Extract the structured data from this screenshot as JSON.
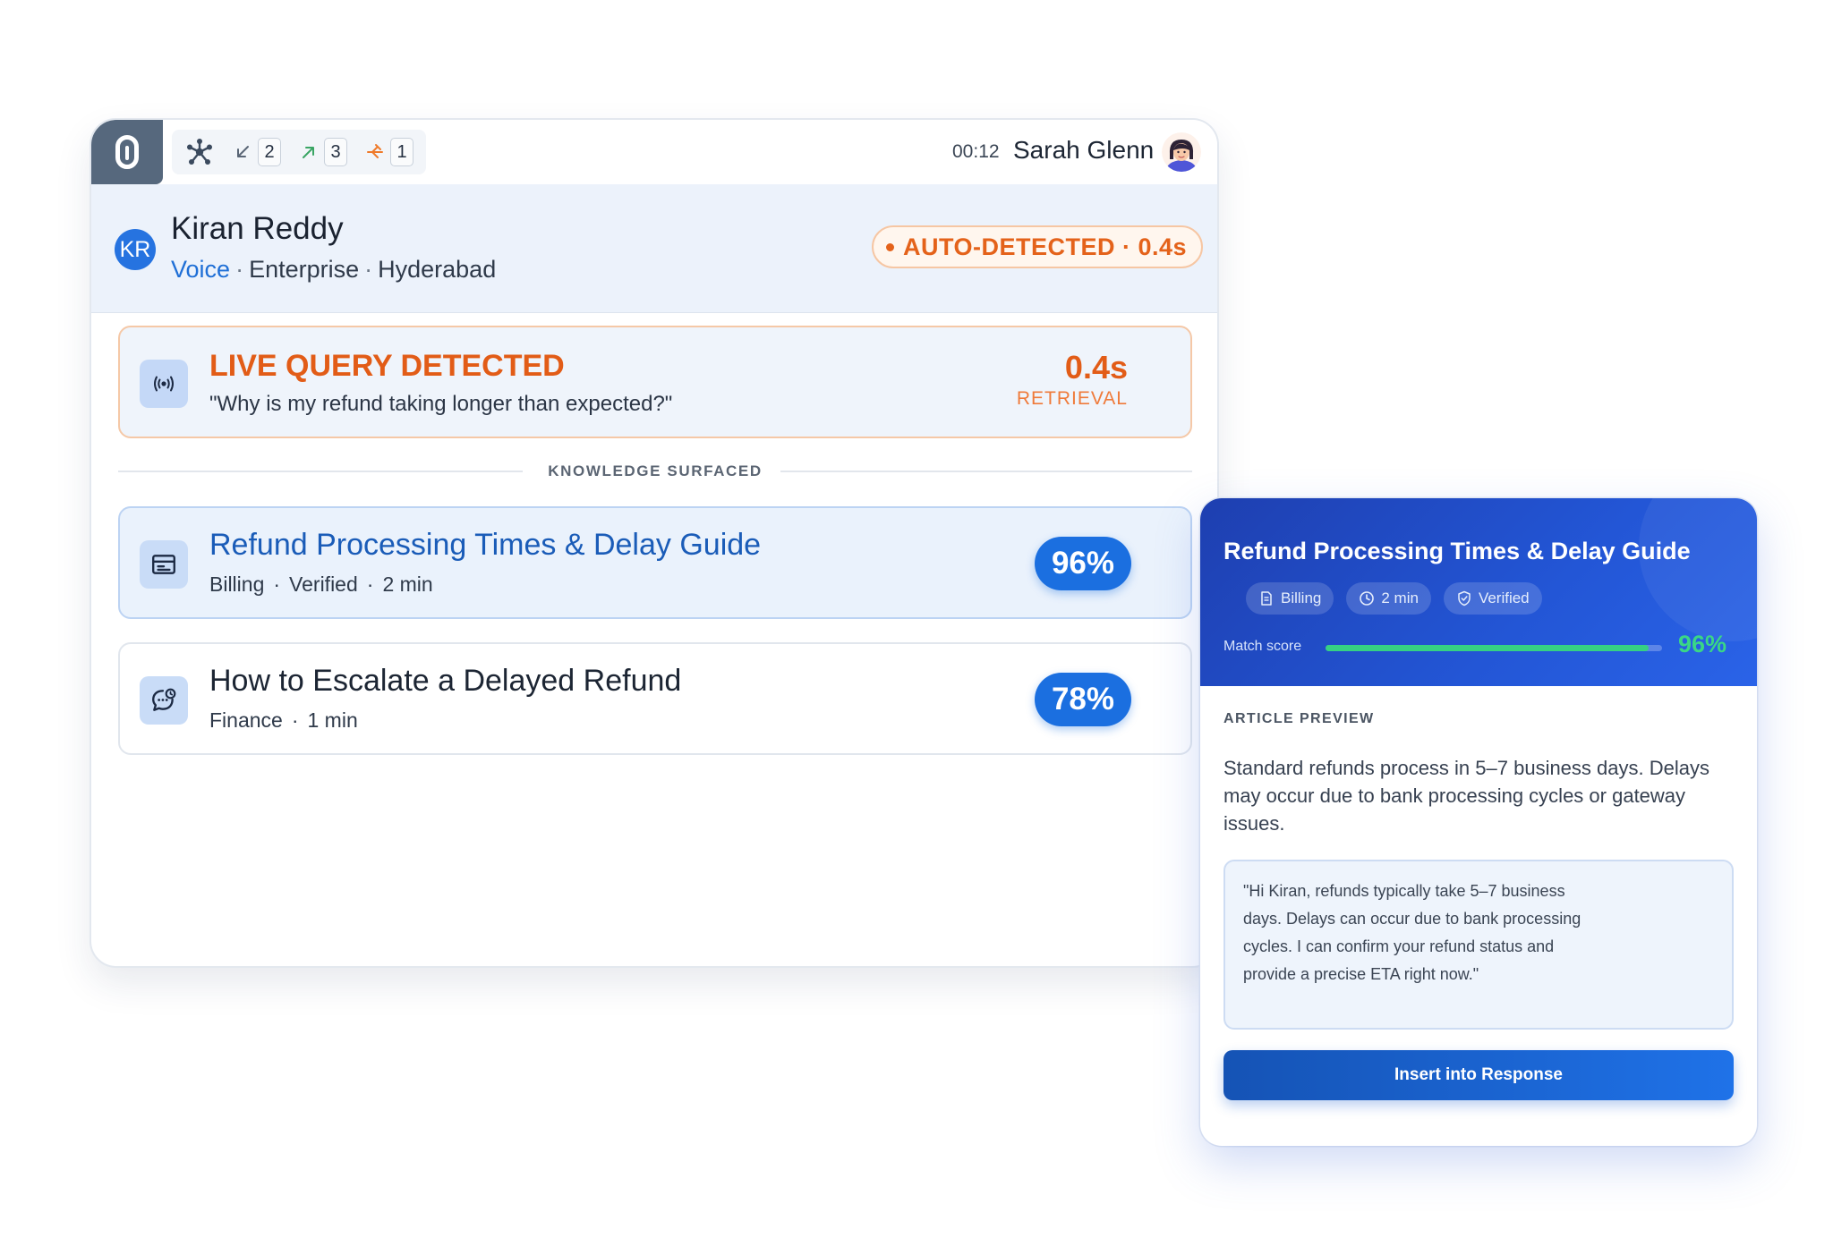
{
  "toolbar": {
    "counts": {
      "inbound": "2",
      "outbound": "3",
      "transfer": "1"
    },
    "timer": "00:12",
    "agent_name": "Sarah Glenn"
  },
  "customer": {
    "initials": "KR",
    "name": "Kiran Reddy",
    "channel": "Voice",
    "tier": "Enterprise",
    "location": "Hyderabad",
    "separator": "·",
    "auto_detected": "AUTO-DETECTED · 0.4s"
  },
  "live_query": {
    "title": "LIVE QUERY DETECTED",
    "quote": "\"Why is my refund taking longer than expected?\"",
    "time": "0.4s",
    "time_label": "RETRIEVAL"
  },
  "divider_label": "KNOWLEDGE SURFACED",
  "knowledge": [
    {
      "title": "Refund Processing Times & Delay Guide",
      "meta": [
        "Billing",
        "·",
        "Verified",
        "·",
        "2 min"
      ],
      "score": "96%",
      "icon": "article-icon",
      "selected": true
    },
    {
      "title": "How to Escalate a Delayed Refund",
      "meta": [
        "Finance",
        "·",
        "1 min"
      ],
      "score": "78%",
      "icon": "chat-clock-icon",
      "selected": false
    }
  ],
  "detail": {
    "title": "Refund Processing Times & Delay Guide",
    "chips": [
      "Billing",
      "2 min",
      "Verified"
    ],
    "match_label": "Match score",
    "match_value": "96%",
    "match_fraction": 0.96,
    "preview_label": "ARTICLE PREVIEW",
    "preview_text": "Standard refunds process in 5–7 business days. Delays may occur due to bank processing cycles or gateway issues.",
    "suggested_reply": "\"Hi Kiran, refunds typically take 5–7 business days. Delays can occur due to bank processing cycles. I can confirm your refund status and provide a precise ETA right now.\"",
    "insert_label": "Insert into Response"
  },
  "colors": {
    "accent": "#1b6fe0",
    "alert_orange": "#e25c17",
    "header_blue": "#2356d6",
    "match_green": "#36d183"
  }
}
